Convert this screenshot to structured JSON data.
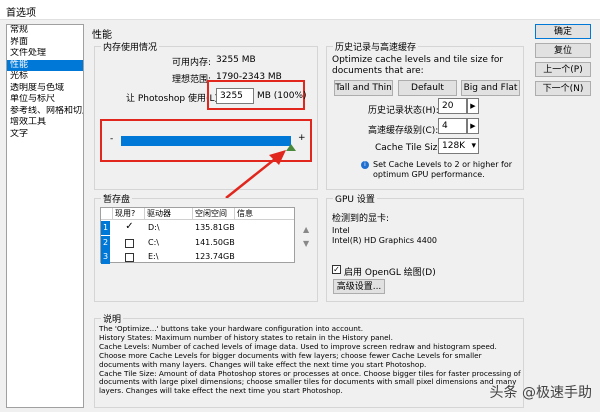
{
  "window": {
    "title": "首选项"
  },
  "nav": {
    "items": [
      "常规",
      "界面",
      "文件处理",
      "性能",
      "光标",
      "透明度与色域",
      "单位与标尺",
      "参考线、网格和切片",
      "增效工具",
      "文字"
    ]
  },
  "section_title": "性能",
  "memory": {
    "group_label": "内存使用情况",
    "available_label": "可用内存:",
    "available_value": "3255 MB",
    "ideal_label": "理想范围:",
    "ideal_value": "1790-2343 MB",
    "let_label": "让 Photoshop 使用(L):",
    "let_value": "3255",
    "let_unit": "MB (100%)",
    "slider_minus": "-",
    "slider_plus": "+",
    "slider_fraction": 1.0
  },
  "history": {
    "group_label": "历史记录与高速缓存",
    "description": "Optimize cache levels and tile size for documents that are:",
    "btn_tall_thin": "Tall and Thin",
    "btn_default": "Default",
    "btn_big_flat": "Big and Flat",
    "history_states_label": "历史记录状态(H):",
    "history_states_value": "20",
    "cache_levels_label": "高速缓存级别(C):",
    "cache_levels_value": "4",
    "tile_size_label": "Cache Tile Size:",
    "tile_size_value": "128K",
    "tip": "Set Cache Levels to 2 or higher for optimum GPU performance."
  },
  "scratch": {
    "group_label": "暂存盘",
    "headers": [
      "现用?",
      "驱动器",
      "空闲空间",
      "信息"
    ],
    "rows": [
      {
        "num": "1",
        "checked": "✓",
        "drive": "D:\\",
        "free": "135.81GB"
      },
      {
        "num": "2",
        "checked": "",
        "drive": "C:\\",
        "free": "141.50GB"
      },
      {
        "num": "3",
        "checked": "",
        "drive": "E:\\",
        "free": "123.74GB"
      }
    ]
  },
  "gpu": {
    "group_label": "GPU 设置",
    "detected_label": "检测到的显卡:",
    "vendor": "Intel",
    "model": "Intel(R) HD Graphics 4400",
    "opengl_label": "启用 OpenGL 绘图(D)",
    "advanced_btn": "高级设置..."
  },
  "buttons": {
    "ok": "确定",
    "reset": "复位",
    "prev": "上一个(P)",
    "next": "下一个(N)"
  },
  "description": {
    "group_label": "说明",
    "text": "The 'Optimize...' buttons take your hardware configuration into account.\nHistory States: Maximum number of history states to retain in the History panel.\nCache Levels: Number of cached levels of image data.  Used to improve screen redraw and histogram speed.  Choose more Cache Levels for bigger documents with few layers; choose fewer Cache Levels for smaller documents with many layers. Changes will take effect the next time you start Photoshop.\nCache Tile Size: Amount of data Photoshop stores or processes at once. Choose bigger tiles for faster processing of documents with large pixel dimensions; choose smaller tiles for documents with small pixel dimensions and many layers. Changes will take effect the next time you start Photoshop."
  },
  "watermark": "头条 @极速手助",
  "colors": {
    "accent": "#0078d7",
    "annotation": "#e0261d"
  }
}
